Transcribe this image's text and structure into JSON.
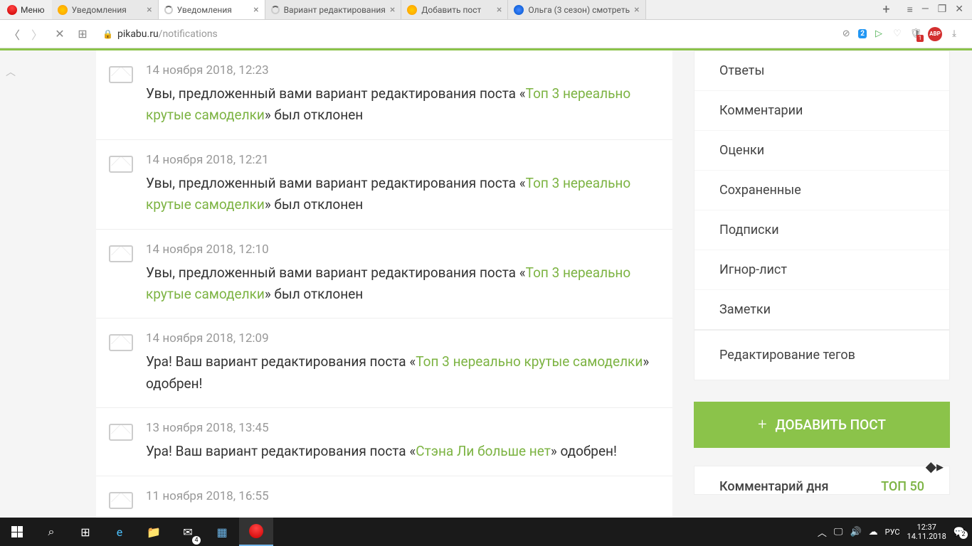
{
  "browser": {
    "menu_label": "Меню",
    "tabs": [
      {
        "title": "Уведомления",
        "favicon": "pikabu"
      },
      {
        "title": "Уведомления",
        "favicon": "loading",
        "active": true
      },
      {
        "title": "Вариант редактирования",
        "favicon": "loading"
      },
      {
        "title": "Добавить пост",
        "favicon": "pikabu"
      },
      {
        "title": "Ольга (3 сезон) смотреть",
        "favicon": "blue"
      }
    ],
    "url_domain": "pikabu.ru",
    "url_path": "/notifications",
    "badge_count": "2",
    "abp_label": "ABP",
    "shield_badge": "1"
  },
  "notifications": [
    {
      "date": "14 ноября 2018, 12:23",
      "prefix": "Увы, предложенный вами вариант редактирования поста «",
      "link": "Топ 3 нереально крутые самоделки",
      "suffix": "» был отклонен"
    },
    {
      "date": "14 ноября 2018, 12:21",
      "prefix": "Увы, предложенный вами вариант редактирования поста «",
      "link": "Топ 3 нереально крутые самоделки",
      "suffix": "» был отклонен"
    },
    {
      "date": "14 ноября 2018, 12:10",
      "prefix": "Увы, предложенный вами вариант редактирования поста «",
      "link": "Топ 3 нереально крутые самоделки",
      "suffix": "» был отклонен"
    },
    {
      "date": "14 ноября 2018, 12:09",
      "prefix": "Ура! Ваш вариант редактирования поста «",
      "link": "Топ 3 нереально крутые самоделки",
      "suffix": "» одобрен!"
    },
    {
      "date": "13 ноября 2018, 13:45",
      "prefix": "Ура! Ваш вариант редактирования поста «",
      "link": "Стэна Ли больше нет",
      "suffix": "» одобрен!"
    },
    {
      "date": "11 ноября 2018, 16:55",
      "prefix": "",
      "link": "",
      "suffix": ""
    }
  ],
  "sidebar": {
    "items": [
      "Ответы",
      "Комментарии",
      "Оценки",
      "Сохраненные",
      "Подписки",
      "Игнор-лист",
      "Заметки"
    ],
    "tag_edit": "Редактирование тегов",
    "add_post": "ДОБАВИТЬ ПОСТ",
    "comment_day": "Комментарий дня",
    "top50": "ТОП 50"
  },
  "taskbar": {
    "lang": "РУС",
    "time": "12:37",
    "date": "14.11.2018",
    "mail_badge": "4",
    "notif_badge": "2"
  }
}
